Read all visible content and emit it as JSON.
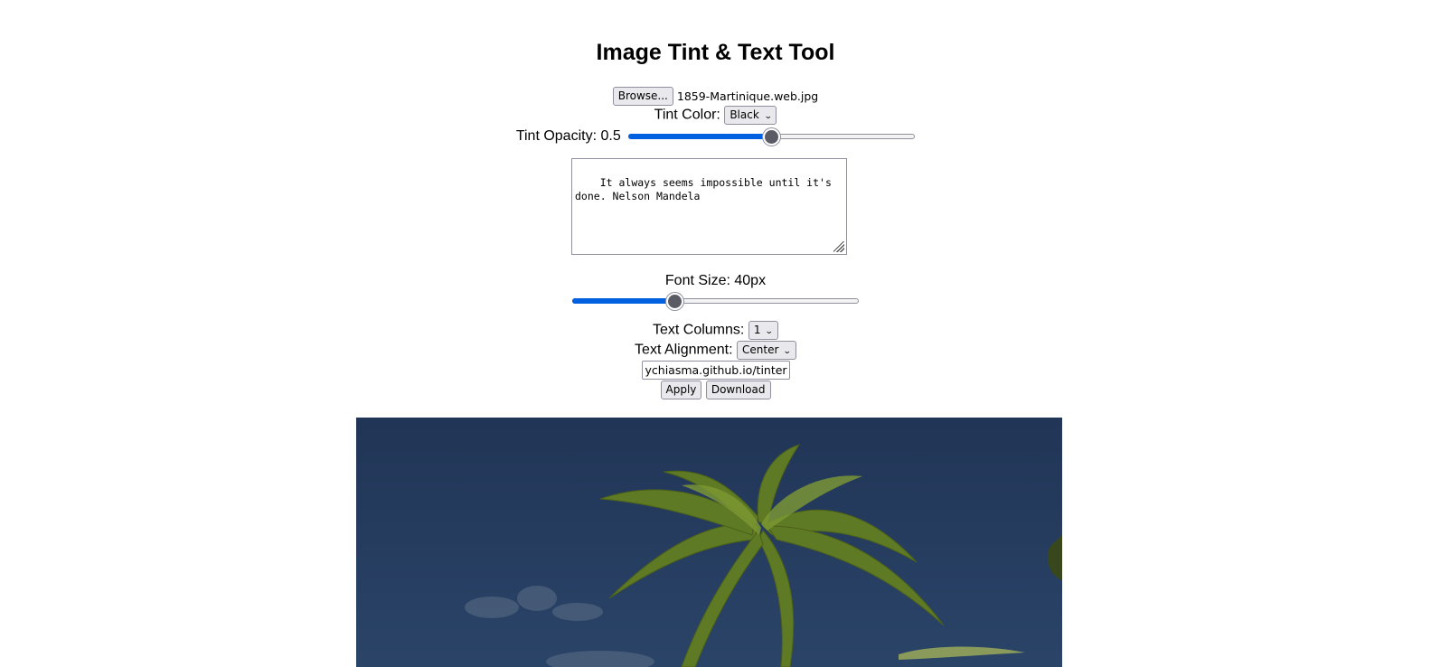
{
  "app": {
    "title": "Image Tint & Text Tool"
  },
  "file": {
    "browse_label": "Browse...",
    "selected_file": "1859-Martinique.web.jpg"
  },
  "tint_color": {
    "label": "Tint Color:",
    "selected": "Black"
  },
  "tint_opacity": {
    "label": "Tint Opacity: 0.5",
    "value": 0.5,
    "min": 0,
    "max": 1
  },
  "text": {
    "value": "It always seems impossible until it's done. Nelson Mandela"
  },
  "font_size": {
    "label": "Font Size: 40px",
    "value": 40,
    "fraction": 0.35
  },
  "text_columns": {
    "label": "Text Columns:",
    "selected": "1"
  },
  "text_alignment": {
    "label": "Text Alignment:",
    "selected": "Center"
  },
  "watermark": {
    "value": "ychiasma.github.io/tinter"
  },
  "actions": {
    "apply_label": "Apply",
    "download_label": "Download"
  },
  "colors": {
    "accent": "#0060df",
    "sky_tinted": "#243a5c",
    "palm_green": "#6f8a2a"
  }
}
